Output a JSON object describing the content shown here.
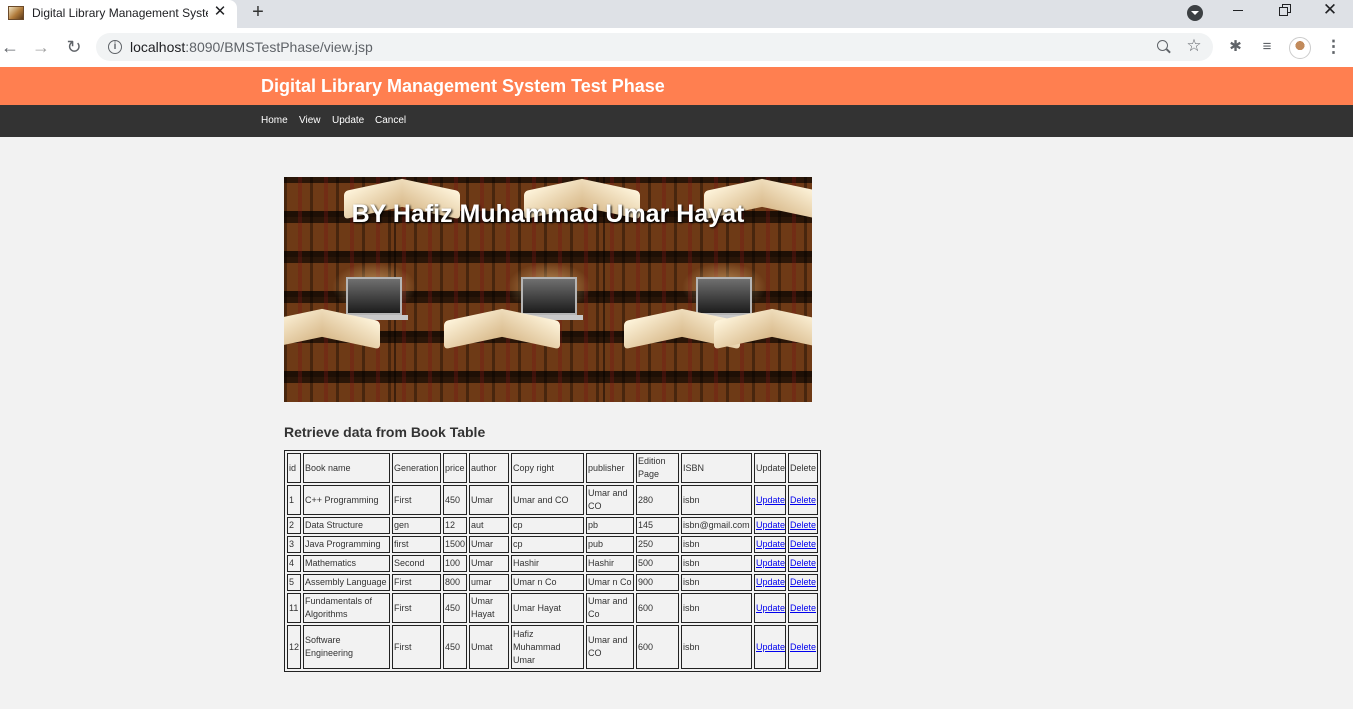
{
  "browser": {
    "tab_title": "Digital Library Management System Test Phase",
    "url_host": "localhost",
    "url_path": ":8090/BMSTestPhase/view.jsp"
  },
  "header": {
    "title": "Digital Library Management System Test Phase"
  },
  "nav": {
    "home": "Home",
    "view": "View",
    "update": "Update",
    "cancel": "Cancel"
  },
  "banner": {
    "title": "BY Hafiz Muhammad Umar Hayat"
  },
  "section": {
    "title": "Retrieve data from Book Table"
  },
  "table": {
    "headers": [
      "id",
      "Book name",
      "Generation",
      "price",
      "author",
      "Copy right",
      "publisher",
      "Edition Page",
      "ISBN",
      "Update",
      "Delete"
    ],
    "rows": [
      {
        "id": "1",
        "name": "C++ Programming",
        "generation": "First",
        "price": "450",
        "author": "Umar",
        "copyright": "Umar and CO",
        "publisher": "Umar and CO",
        "edition": "280",
        "isbn": "isbn",
        "update": "Update",
        "delete": "Delete"
      },
      {
        "id": "2",
        "name": "Data Structure",
        "generation": "gen",
        "price": "12",
        "author": "aut",
        "copyright": "cp",
        "publisher": "pb",
        "edition": "145",
        "isbn": "isbn@gmail.com",
        "update": "Update",
        "delete": "Delete"
      },
      {
        "id": "3",
        "name": "Java Programming",
        "generation": "first",
        "price": "1500",
        "author": "Umar",
        "copyright": "cp",
        "publisher": "pub",
        "edition": "250",
        "isbn": "isbn",
        "update": "Update",
        "delete": "Delete"
      },
      {
        "id": "4",
        "name": "Mathematics",
        "generation": "Second",
        "price": "100",
        "author": "Umar",
        "copyright": "Hashir",
        "publisher": "Hashir",
        "edition": "500",
        "isbn": "isbn",
        "update": "Update",
        "delete": "Delete"
      },
      {
        "id": "5",
        "name": "Assembly Language",
        "generation": "First",
        "price": "800",
        "author": "umar",
        "copyright": "Umar n Co",
        "publisher": "Umar n Co",
        "edition": "900",
        "isbn": "isbn",
        "update": "Update",
        "delete": "Delete"
      },
      {
        "id": "11",
        "name": "Fundamentals of Algorithms",
        "generation": "First",
        "price": "450",
        "author": "Umar Hayat",
        "copyright": "Umar Hayat",
        "publisher": "Umar and Co",
        "edition": "600",
        "isbn": "isbn",
        "update": "Update",
        "delete": "Delete"
      },
      {
        "id": "12",
        "name": "Software Engineering",
        "generation": "First",
        "price": "450",
        "author": "Umat",
        "copyright": "Hafiz Muhammad Umar",
        "publisher": "Umar and CO",
        "edition": "600",
        "isbn": "isbn",
        "update": "Update",
        "delete": "Delete"
      }
    ]
  },
  "colors": {
    "header_bg": "#ff7f50",
    "nav_bg": "#333333",
    "page_bg": "#f2f2f2",
    "link": "#0000ee"
  }
}
